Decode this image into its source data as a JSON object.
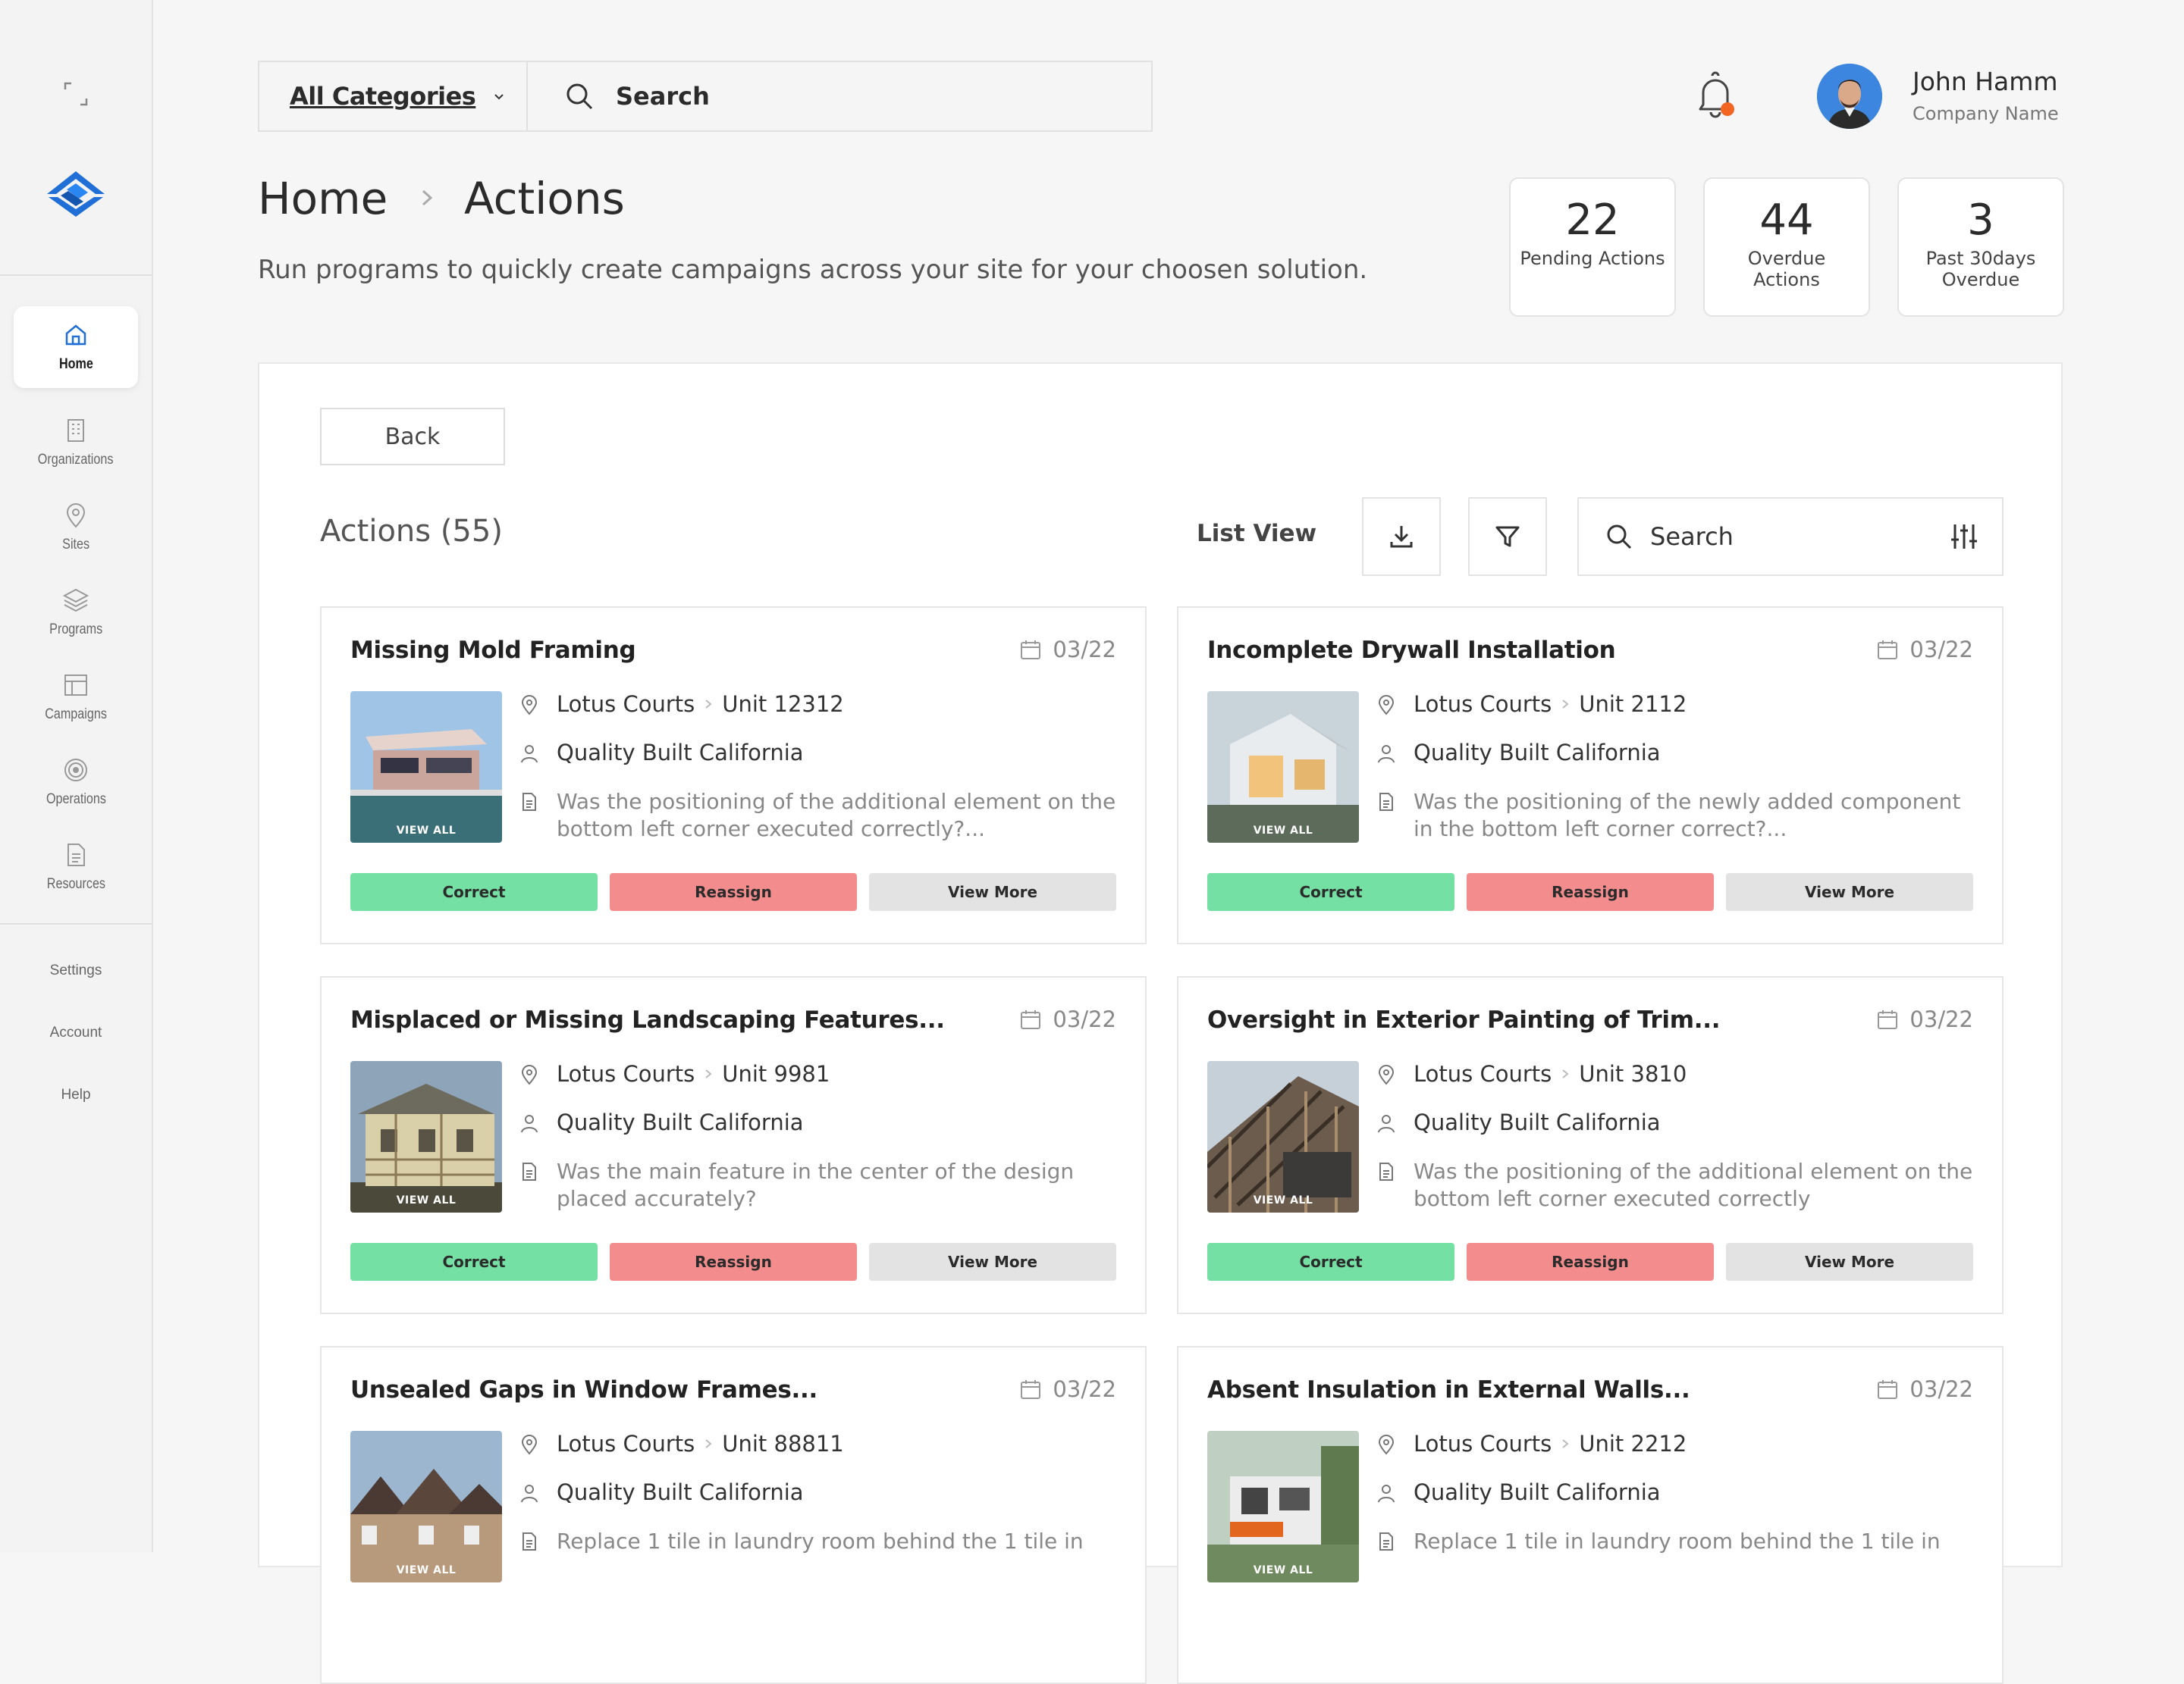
{
  "sidebar": {
    "nav": [
      {
        "label": "Home",
        "icon": "home-icon",
        "active": true
      },
      {
        "label": "Organizations",
        "icon": "building-icon"
      },
      {
        "label": "Sites",
        "icon": "location-pin-icon"
      },
      {
        "label": "Programs",
        "icon": "layers-icon"
      },
      {
        "label": "Campaigns",
        "icon": "layout-icon"
      },
      {
        "label": "Operations",
        "icon": "target-icon"
      },
      {
        "label": "Resources",
        "icon": "document-icon"
      }
    ],
    "bottom": [
      "Settings",
      "Account",
      "Help"
    ]
  },
  "header": {
    "category": "All Categories",
    "search_placeholder": "Search",
    "user": {
      "name": "John Hamm",
      "company": "Company Name"
    }
  },
  "breadcrumb": {
    "home": "Home",
    "current": "Actions"
  },
  "description": "Run programs to quickly create campaigns across your site for your choosen solution.",
  "stats": [
    {
      "value": "22",
      "label": "Pending Actions"
    },
    {
      "value": "44",
      "label": "Overdue Actions"
    },
    {
      "value": "3",
      "label": "Past 30days Overdue"
    }
  ],
  "panel": {
    "back_label": "Back",
    "list_title": "Actions (55)",
    "view_label": "List View",
    "search_placeholder": "Search"
  },
  "card_buttons": {
    "correct": "Correct",
    "reassign": "Reassign",
    "more": "View More",
    "view_all": "VIEW ALL"
  },
  "cards": [
    {
      "title": "Missing Mold Framing",
      "date": "03/22",
      "site": "Lotus Courts",
      "unit": "Unit 12312",
      "company": "Quality Built California",
      "desc": "Was the positioning of the additional element on the bottom left corner executed correctly?..."
    },
    {
      "title": "Incomplete Drywall Installation",
      "date": "03/22",
      "site": "Lotus Courts",
      "unit": "Unit 2112",
      "company": "Quality Built California",
      "desc": "Was the positioning of the newly added component in the bottom left corner correct?..."
    },
    {
      "title": "Misplaced or Missing Landscaping Features...",
      "date": "03/22",
      "site": "Lotus Courts",
      "unit": "Unit 9981",
      "company": "Quality Built California",
      "desc": "Was the main feature in the center of the design placed accurately?"
    },
    {
      "title": "Oversight in Exterior Painting of Trim...",
      "date": "03/22",
      "site": "Lotus Courts",
      "unit": "Unit 3810",
      "company": "Quality Built California",
      "desc": "Was the positioning of the additional element on the bottom left corner executed correctly"
    },
    {
      "title": "Unsealed Gaps in Window Frames...",
      "date": "03/22",
      "site": "Lotus Courts",
      "unit": "Unit 88811",
      "company": "Quality Built California",
      "desc": "Replace 1 tile in laundry room behind the 1 tile in"
    },
    {
      "title": "Absent Insulation in External Walls...",
      "date": "03/22",
      "site": "Lotus Courts",
      "unit": "Unit 2212",
      "company": "Quality Built California",
      "desc": "Replace 1 tile in laundry room behind the 1 tile in"
    }
  ],
  "colors": {
    "accent": "#1f6fd6",
    "correct": "#74e0a4",
    "reassign": "#f38c8c",
    "more": "#e3e3e3",
    "notification": "#f26522"
  }
}
